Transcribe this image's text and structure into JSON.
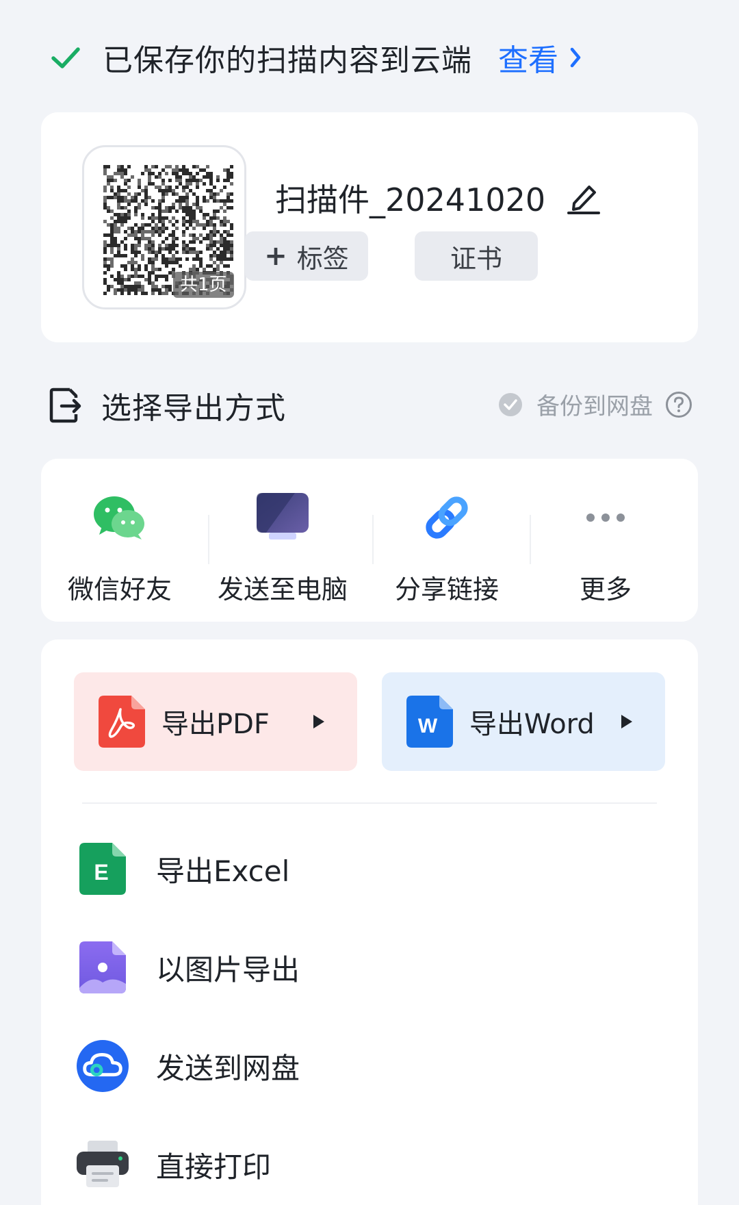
{
  "banner": {
    "message": "已保存你的扫描内容到云端",
    "view_label": "查看",
    "accent_color": "#1e6fff",
    "check_color": "#1aad64"
  },
  "document": {
    "title": "扫描件_20241020",
    "page_count_label": "共1页",
    "add_tag_label": "标签",
    "tag_label": "证书"
  },
  "export_section": {
    "title": "选择导出方式",
    "backup_label": "备份到网盘"
  },
  "share": {
    "items": [
      {
        "label": "微信好友",
        "icon": "wechat-icon"
      },
      {
        "label": "发送至电脑",
        "icon": "computer-icon"
      },
      {
        "label": "分享链接",
        "icon": "link-icon"
      },
      {
        "label": "更多",
        "icon": "more-icon"
      }
    ]
  },
  "export": {
    "pdf_label": "导出PDF",
    "word_label": "导出Word",
    "rows": [
      {
        "label": "导出Excel",
        "icon": "excel-icon"
      },
      {
        "label": "以图片导出",
        "icon": "image-file-icon"
      },
      {
        "label": "发送到网盘",
        "icon": "cloud-drive-icon"
      },
      {
        "label": "直接打印",
        "icon": "printer-icon"
      }
    ]
  }
}
